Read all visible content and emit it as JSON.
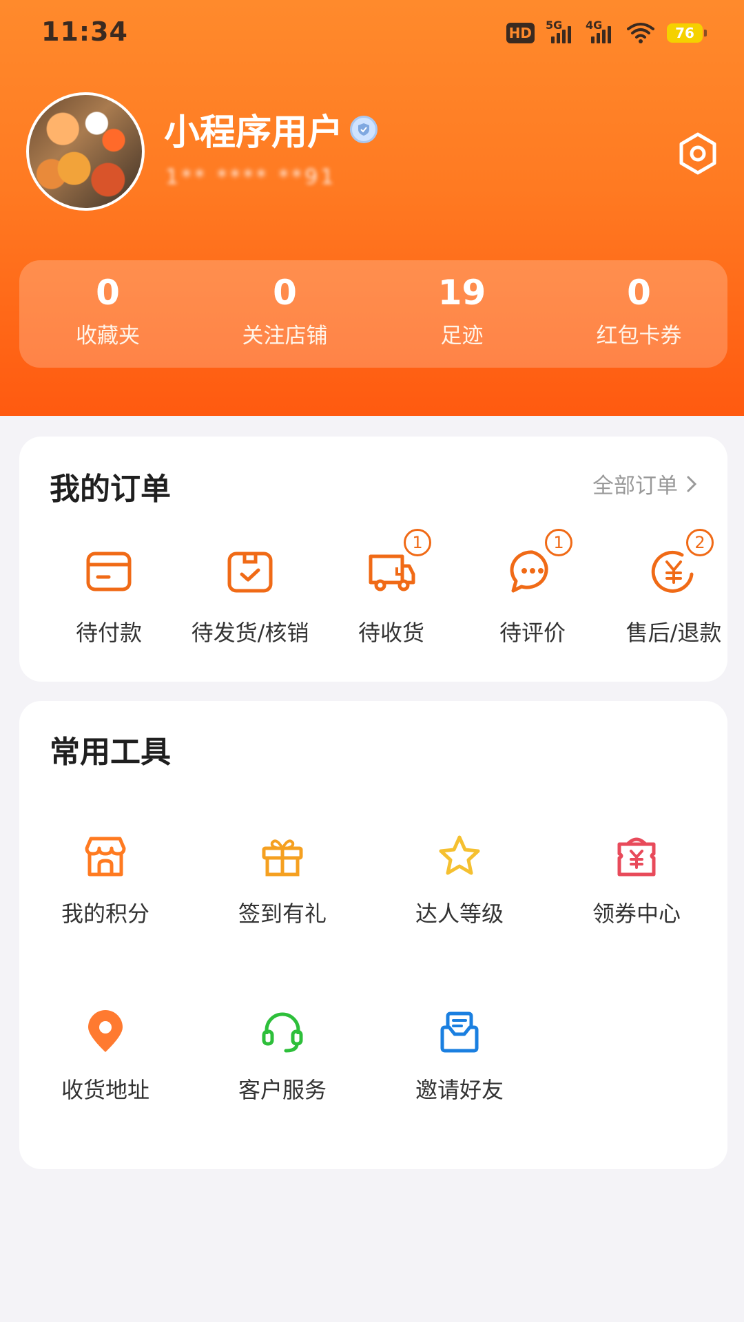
{
  "status_bar": {
    "time": "11:34",
    "hd": "HD",
    "net1": "5G",
    "net2": "4G",
    "battery": "76"
  },
  "profile": {
    "username": "小程序用户",
    "user_id_masked": "1** **** **91",
    "verified_icon": "verified-shield-icon",
    "settings_icon": "settings-hex-icon"
  },
  "stats": [
    {
      "value": "0",
      "label": "收藏夹"
    },
    {
      "value": "0",
      "label": "关注店铺"
    },
    {
      "value": "19",
      "label": "足迹"
    },
    {
      "value": "0",
      "label": "红包卡券"
    }
  ],
  "orders": {
    "title": "我的订单",
    "all_label": "全部订单",
    "items": [
      {
        "label": "待付款",
        "icon": "wallet-card-icon",
        "badge": ""
      },
      {
        "label": "待发货/核销",
        "icon": "box-check-icon",
        "badge": ""
      },
      {
        "label": "待收货",
        "icon": "truck-icon",
        "badge": "1"
      },
      {
        "label": "待评价",
        "icon": "chat-bubble-icon",
        "badge": "1"
      },
      {
        "label": "售后/退款",
        "icon": "yuan-refund-icon",
        "badge": "2"
      }
    ]
  },
  "tools": {
    "title": "常用工具",
    "items": [
      {
        "label": "我的积分",
        "icon": "store-icon"
      },
      {
        "label": "签到有礼",
        "icon": "gift-icon"
      },
      {
        "label": "达人等级",
        "icon": "star-icon"
      },
      {
        "label": "领券中心",
        "icon": "coupon-bag-icon"
      },
      {
        "label": "收货地址",
        "icon": "location-pin-icon"
      },
      {
        "label": "客户服务",
        "icon": "headset-icon"
      },
      {
        "label": "邀请好友",
        "icon": "invite-mail-icon"
      }
    ]
  },
  "colors": {
    "accent": "#f06a16",
    "header_top": "#ff8a2c",
    "header_bottom": "#ff5a10",
    "gift": "#f5a020",
    "star": "#f5c030",
    "coupon": "#e84a5a",
    "location": "#ff7a30",
    "headset": "#2dbf3a",
    "invite": "#1a7fe0"
  }
}
